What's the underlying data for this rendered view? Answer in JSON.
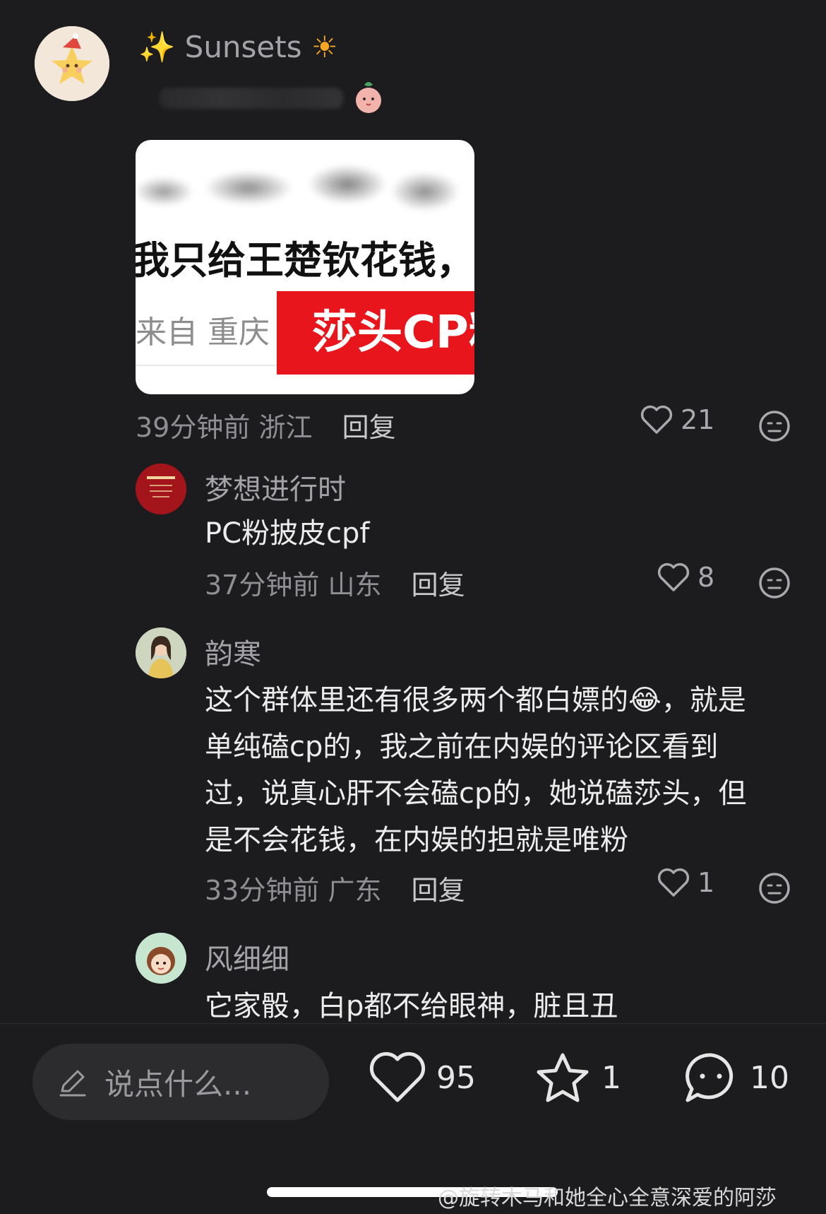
{
  "main_comment": {
    "username_prefix": "✨",
    "username": "Sunsets",
    "username_suffix": "☀",
    "image": {
      "line1": "我只给王楚钦花钱，",
      "line2": "来自 重庆",
      "red_label": "莎头CP粉"
    },
    "time": "39分钟前",
    "location": "浙江",
    "reply_label": "回复",
    "likes": "21"
  },
  "replies": [
    {
      "username": "梦想进行时",
      "text": "PC粉披皮cpf",
      "time": "37分钟前",
      "location": "山东",
      "reply_label": "回复",
      "likes": "8"
    },
    {
      "username": "韵寒",
      "text_lines": [
        "这个群体里还有很多两个都白嫖的😂，就是",
        "单纯磕cp的，我之前在内娱的评论区看到",
        "过，说真心肝不会磕cp的，她说磕莎头，但",
        "是不会花钱，在内娱的担就是唯粉"
      ],
      "time": "33分钟前",
      "location": "广东",
      "reply_label": "回复",
      "likes": "1"
    },
    {
      "username": "风细细",
      "text": "它家骰，白p都不给眼神，脏且丑"
    }
  ],
  "bottom_bar": {
    "input_placeholder": "说点什么...",
    "likes": "95",
    "stars": "1",
    "comments": "10"
  },
  "watermark": "@旋转木马和她全心全意深爱的阿莎",
  "colors": {
    "background": "#1c1c1e",
    "red_label": "#e8161c"
  }
}
